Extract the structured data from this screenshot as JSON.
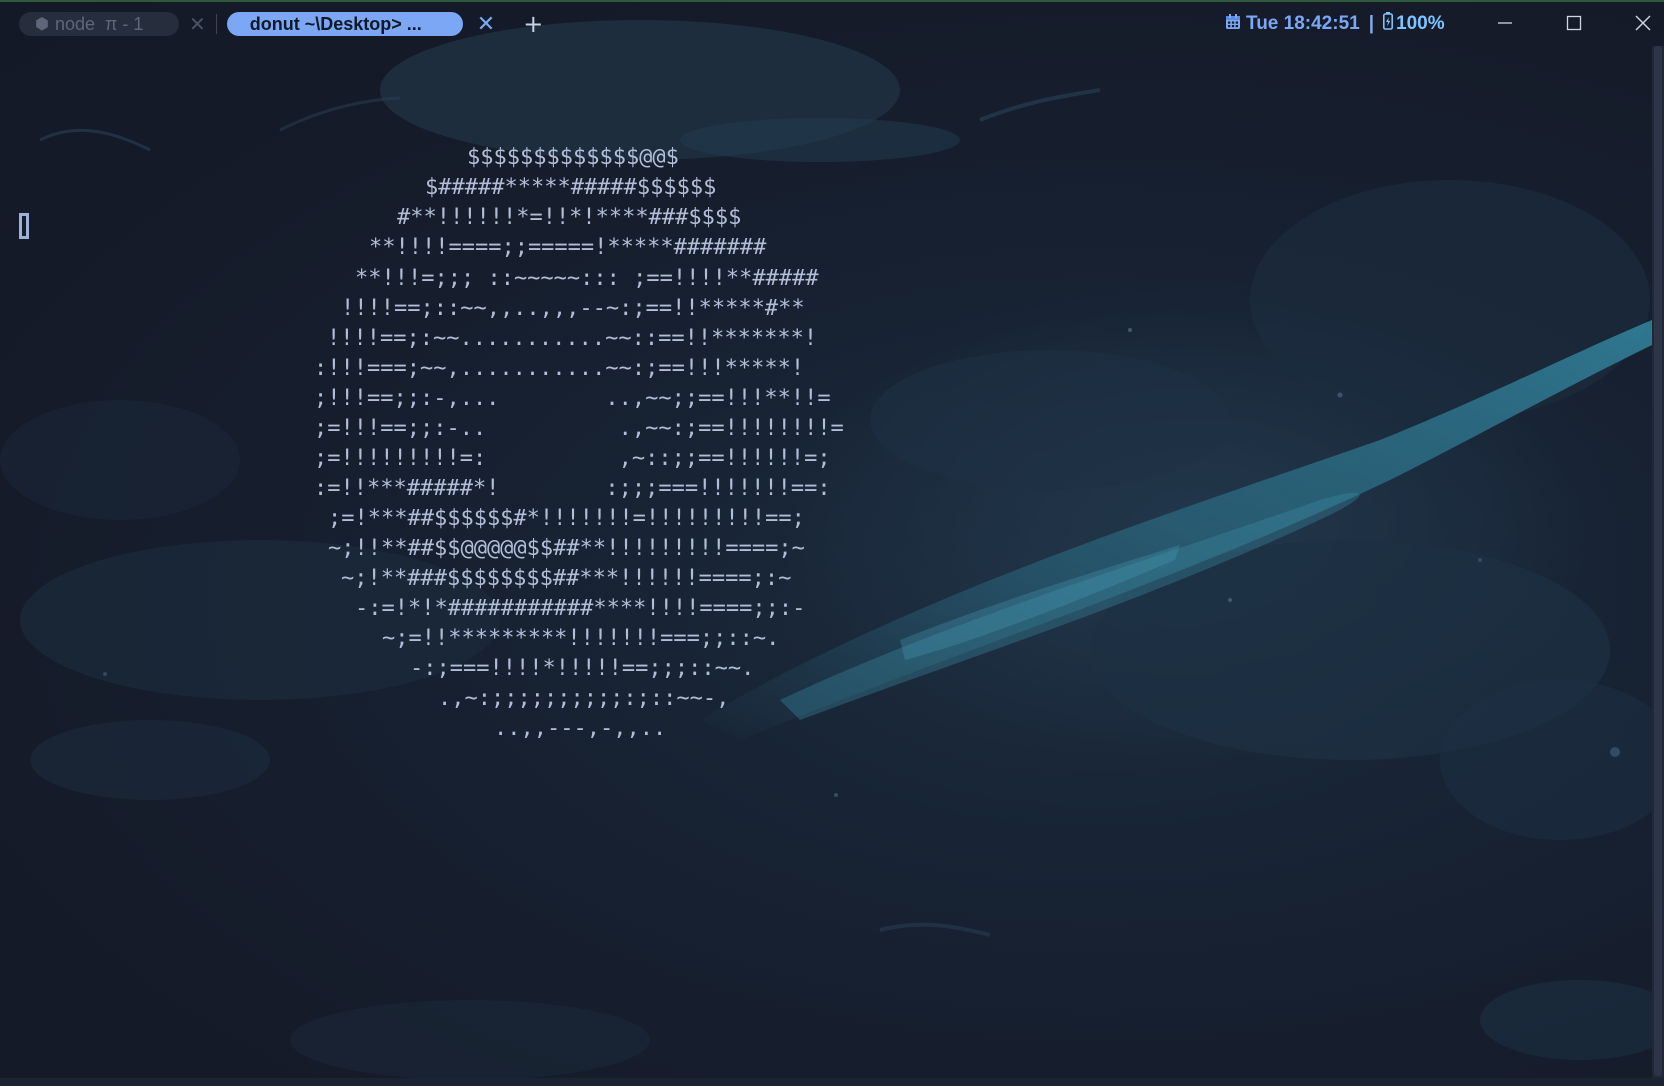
{
  "tabs": [
    {
      "title": "node",
      "subtitle": "π - 1",
      "active": false
    },
    {
      "title": "donut  ~\\Desktop> ...",
      "active": true
    }
  ],
  "status": {
    "datetime": "Tue 18:42:51",
    "separator": "|",
    "battery": "100%"
  },
  "icons": {
    "tab_inactive": "node-icon",
    "calendar": "calendar-icon",
    "battery": "battery-icon",
    "minimize": "minimize-icon",
    "maximize": "maximize-icon",
    "close": "close-icon",
    "new_tab": "plus-icon"
  },
  "colors": {
    "accent": "#7ba7f5",
    "terminal_text": "#b2bdd8",
    "background": "#161c2a"
  },
  "terminal": {
    "donut_lines": [
      "$$$$$$$$$$$$$@@$",
      "$#####*****#####$$$$$$",
      "#**!!!!!!*=!!*!****###$$$$",
      "**!!!!====;;=====!*****#######",
      "**!!!=;;; ::~~~~~::: ;==!!!!**#####",
      "!!!!==;::~~,,..,,,--~:;==!!*****#**",
      "!!!!==;:~~...........~~::==!!*******!",
      ":!!!===;~~,...........~~:;==!!!*****!",
      ";!!!==;;:-,...        ..,~~;;==!!!**!!=",
      ";=!!!==;;:-..          .,~~:;==!!!!!!!!=",
      ";=!!!!!!!!!=:          ,~::;;==!!!!!!=;",
      ":=!!***#####*!        :;;;===!!!!!!!==:",
      ";=!***##$$$$$$#*!!!!!!!=!!!!!!!!!==;",
      "~;!!**##$$@@@@@$$##**!!!!!!!!!====;~",
      "~;!**###$$$$$$$$##***!!!!!!====;:~",
      "-:=!*!*###########****!!!!====;;:-",
      "~;=!!*********!!!!!!!===;;::~.",
      "-:;===!!!!*!!!!!==;;;::~~.",
      ".,~:;;;;;;;;;;:;::~~-,",
      "..,,---,-,,.."
    ]
  }
}
